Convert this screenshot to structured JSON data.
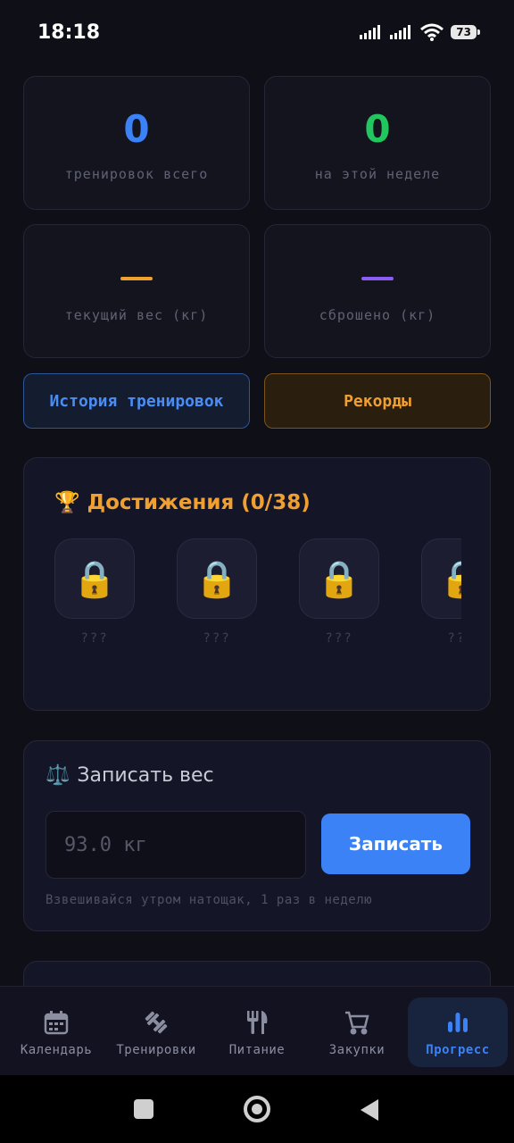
{
  "status_bar": {
    "time": "18:18",
    "battery": "73"
  },
  "stats": {
    "total": {
      "value": "0",
      "label": "тренировок всего"
    },
    "week": {
      "value": "0",
      "label": "на этой неделе"
    },
    "current_weight": {
      "value": "—",
      "label": "текущий вес (кг)"
    },
    "lost": {
      "value": "—",
      "label": "сброшено (кг)"
    }
  },
  "buttons": {
    "history": "История тренировок",
    "records": "Рекорды"
  },
  "achievements": {
    "icon": "🏆",
    "title": "Достижения (0/38)",
    "items": [
      {
        "icon": "🔒",
        "name": "???"
      },
      {
        "icon": "🔒",
        "name": "???"
      },
      {
        "icon": "🔒",
        "name": "???"
      },
      {
        "icon": "🔒",
        "name": "???"
      }
    ]
  },
  "weight": {
    "icon": "⚖️",
    "title": "Записать вес",
    "placeholder": "93.0 кг",
    "submit": "Записать",
    "hint": "Взвешивайся утром натощак, 1 раз в неделю"
  },
  "nav": {
    "items": [
      {
        "label": "Календарь",
        "icon": "calendar-icon"
      },
      {
        "label": "Тренировки",
        "icon": "dumbbell-icon"
      },
      {
        "label": "Питание",
        "icon": "utensils-icon"
      },
      {
        "label": "Закупки",
        "icon": "cart-icon"
      },
      {
        "label": "Прогресс",
        "icon": "bar-chart-icon",
        "active": true
      }
    ]
  },
  "colors": {
    "accent_blue": "#3b82f6",
    "accent_green": "#22c55e",
    "accent_orange": "#f0a030",
    "accent_purple": "#8b5cf6"
  }
}
